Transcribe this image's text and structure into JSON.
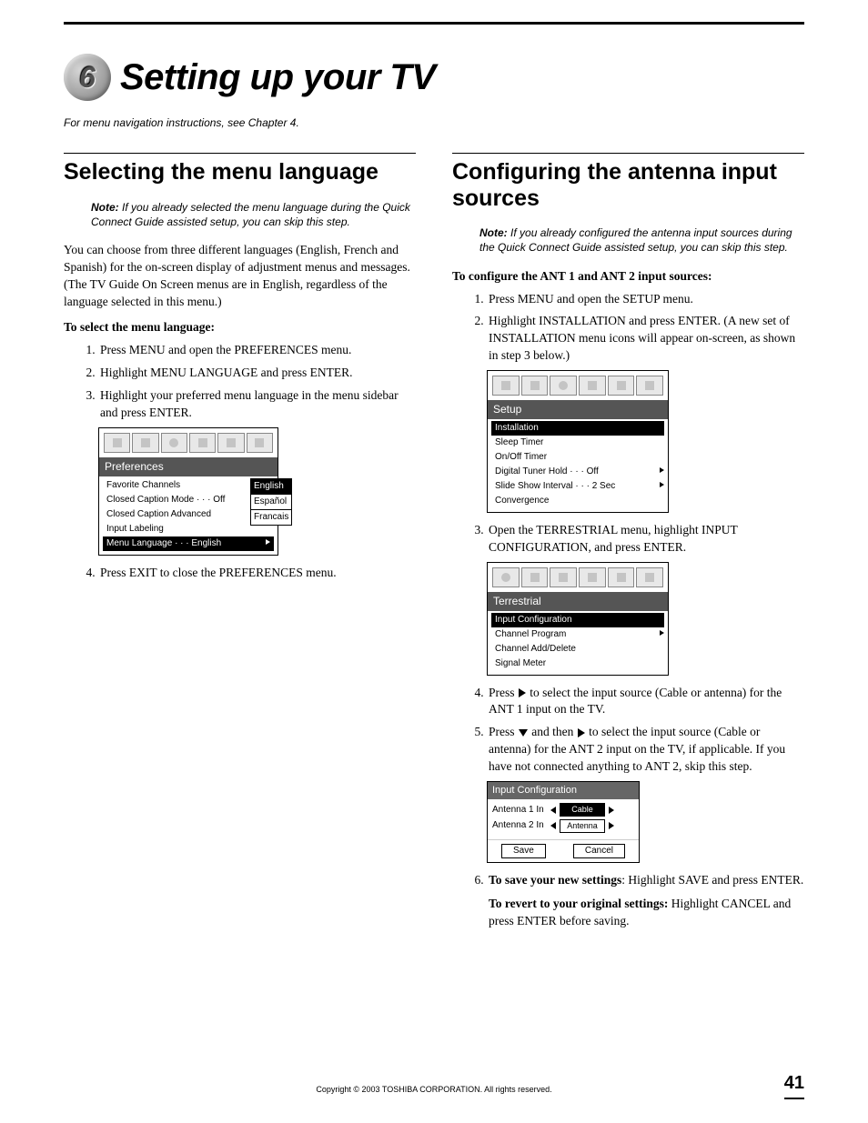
{
  "chapter": {
    "number": "6",
    "title": "Setting up your TV"
  },
  "intro": "For menu navigation instructions, see Chapter 4.",
  "left": {
    "heading": "Selecting the menu language",
    "note_label": "Note:",
    "note": "If you already selected the menu language during the Quick Connect Guide assisted setup, you can skip this step.",
    "para": "You can choose from three different languages (English, French and Spanish) for the on-screen display of adjustment menus and messages. (The TV Guide On Screen menus are in English, regardless of the language selected in this menu.)",
    "subhead": "To select the menu language:",
    "steps": [
      "Press MENU and open the PREFERENCES menu.",
      "Highlight MENU LANGUAGE and press ENTER.",
      "Highlight your preferred menu language in the menu sidebar and press ENTER."
    ],
    "step4": "Press EXIT to close the PREFERENCES menu.",
    "menu": {
      "title": "Preferences",
      "rows": [
        {
          "label": "Favorite Channels"
        },
        {
          "label": "Closed Caption Mode",
          "value": "Off",
          "arrow": true
        },
        {
          "label": "Closed Caption Advanced"
        },
        {
          "label": "Input Labeling"
        },
        {
          "label": "Menu Language",
          "value": "English",
          "arrow": true,
          "highlight": true
        }
      ],
      "side_options": [
        "English",
        "Español",
        "Francais"
      ],
      "side_highlight": 0
    }
  },
  "right": {
    "heading": "Configuring the antenna input sources",
    "note_label": "Note:",
    "note": "If you already configured the antenna input sources during the Quick Connect Guide assisted setup, you can skip this step.",
    "subhead": "To configure the ANT 1 and ANT 2 input sources:",
    "step1": "Press MENU and open the SETUP menu.",
    "step2": "Highlight INSTALLATION and press ENTER. (A new set of INSTALLATION menu icons will appear on-screen, as shown in step 3 below.)",
    "setup_menu": {
      "title": "Setup",
      "rows": [
        {
          "label": "Installation",
          "highlight": true
        },
        {
          "label": "Sleep Timer"
        },
        {
          "label": "On/Off Timer"
        },
        {
          "label": "Digital Tuner Hold",
          "value": "Off",
          "arrow": true
        },
        {
          "label": "Slide Show Interval",
          "value": "2 Sec",
          "arrow": true
        },
        {
          "label": "Convergence"
        }
      ]
    },
    "step3": "Open the TERRESTRIAL menu, highlight INPUT CONFIGURATION, and press ENTER.",
    "terrestrial_menu": {
      "title": "Terrestrial",
      "rows": [
        {
          "label": "Input Configuration",
          "highlight": true
        },
        {
          "label": "Channel Program",
          "arrow": true
        },
        {
          "label": "Channel Add/Delete"
        },
        {
          "label": "Signal Meter"
        }
      ]
    },
    "step4_pre": "Press ",
    "step4_post": " to select the input source (Cable or antenna) for the ANT 1 input on the TV.",
    "step5_pre": "Press ",
    "step5_mid": " and then ",
    "step5_post": " to select the input source (Cable or antenna) for the ANT 2 input on the TV, if applicable. If you have not connected anything to ANT 2, skip this step.",
    "input_config": {
      "title": "Input Configuration",
      "rows": [
        {
          "label": "Antenna 1 In",
          "value": "Cable",
          "highlight": true
        },
        {
          "label": "Antenna 2 In",
          "value": "Antenna"
        }
      ],
      "save": "Save",
      "cancel": "Cancel"
    },
    "step6_bold": "To save your new settings",
    "step6_rest": ": Highlight SAVE and press ENTER.",
    "step6b_bold": "To revert to your original settings:",
    "step6b_rest": " Highlight CANCEL and press ENTER before saving."
  },
  "footer": {
    "copyright": "Copyright © 2003 TOSHIBA CORPORATION. All rights reserved.",
    "page": "41"
  }
}
